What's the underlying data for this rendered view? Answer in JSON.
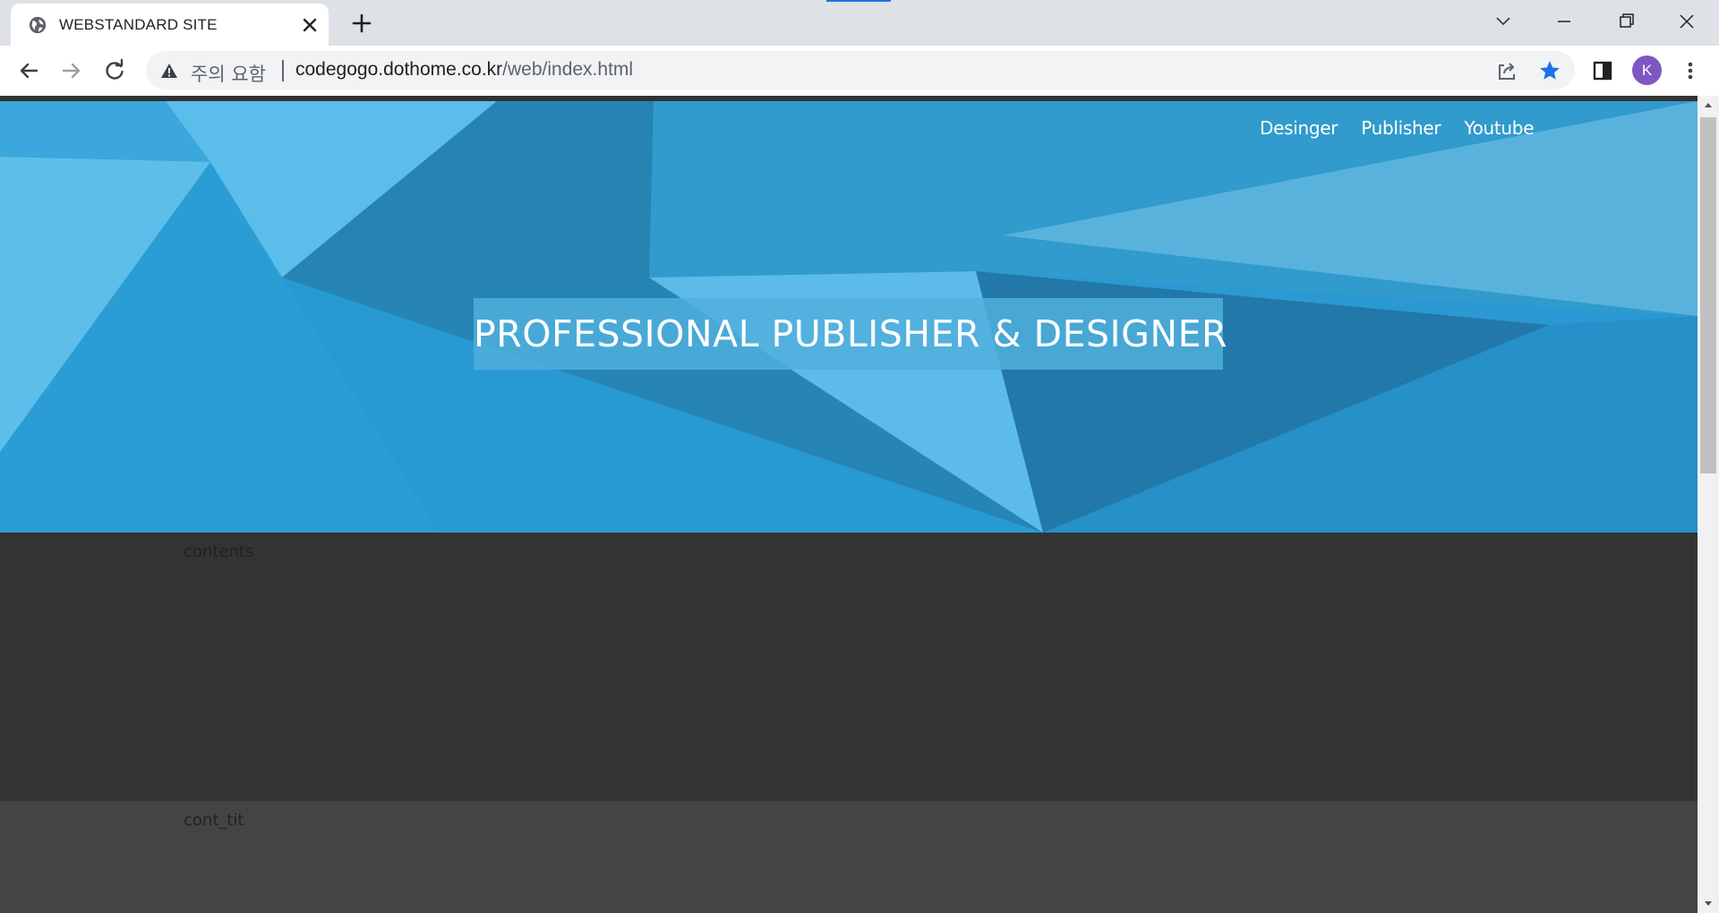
{
  "browser": {
    "tab_title": "WEBSTANDARD SITE",
    "security_label": "주의 요함",
    "url_host": "codegogo.dothome.co.kr",
    "url_path": "/web/index.html",
    "profile_initial": "K",
    "accent_color": "#1a73e8",
    "profile_color": "#7e57c2"
  },
  "site": {
    "nav": [
      "Desinger",
      "Publisher",
      "Youtube"
    ],
    "hero_title": "PROFESSIONAL PUBLISHER & DESIGNER",
    "sections": {
      "contents": "contents",
      "cont_tit": "cont_tit"
    },
    "colors": {
      "hero_blue": "#2ba0d8",
      "contents_bg": "#333333",
      "cont_tit_bg": "#444444"
    }
  }
}
